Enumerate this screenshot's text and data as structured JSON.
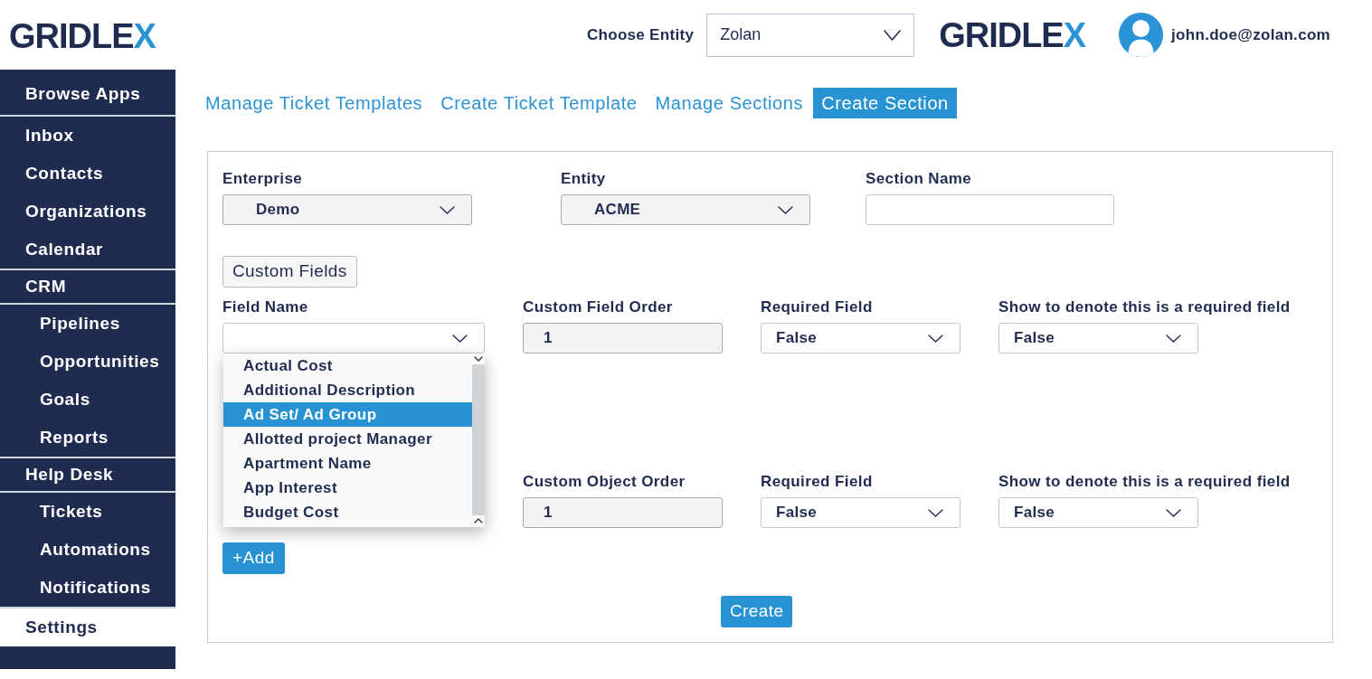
{
  "header": {
    "logo": "GRIDLEX",
    "entity_label": "Choose Entity",
    "entity_select": {
      "value": "Zolan"
    },
    "logo_right": "GRIDLEX",
    "user_email": "john.doe@zolan.com"
  },
  "sidebar": {
    "groups": [
      {
        "items": [
          {
            "label": "Browse Apps",
            "selected": false
          }
        ]
      },
      {
        "items": [
          {
            "label": "Inbox",
            "selected": false
          },
          {
            "label": "Contacts",
            "selected": false
          },
          {
            "label": "Organizations",
            "selected": false
          },
          {
            "label": "Calendar",
            "selected": false
          }
        ]
      },
      {
        "items": [
          {
            "label": "CRM",
            "selected": false,
            "children": [
              {
                "label": "Pipelines",
                "selected": false
              },
              {
                "label": "Opportunities",
                "selected": false
              },
              {
                "label": "Goals",
                "selected": false
              },
              {
                "label": "Reports",
                "selected": false
              }
            ]
          }
        ]
      },
      {
        "items": [
          {
            "label": "Help Desk",
            "selected": false,
            "children": [
              {
                "label": "Tickets",
                "selected": false
              },
              {
                "label": "Automations",
                "selected": false
              },
              {
                "label": "Notifications",
                "selected": false
              }
            ]
          }
        ]
      },
      {
        "items": [
          {
            "label": "Settings",
            "selected": true
          }
        ]
      }
    ]
  },
  "tabs": [
    {
      "label": "Manage Ticket Templates",
      "selected": false
    },
    {
      "label": "Create Ticket Template",
      "selected": false
    },
    {
      "label": "Manage Sections",
      "selected": false
    },
    {
      "label": "Create Section",
      "selected": true
    }
  ],
  "form": {
    "fields": [
      {
        "label": "Enterprise",
        "kind": "select",
        "value": "Demo",
        "disabled": true
      },
      {
        "label": "Entity",
        "kind": "select",
        "value": "ACME",
        "disabled": true
      },
      {
        "label": "Section Name",
        "kind": "text",
        "disabled": false
      }
    ],
    "custom_fields_button": "Custom Fields",
    "field_rows": [
      {
        "fields": [
          {
            "label": "Field Name",
            "kind": "select",
            "disabled": false,
            "expanded": true,
            "options": [
              {
                "label": "Actual Cost",
                "selected": false
              },
              {
                "label": "Additional Description",
                "selected": false
              },
              {
                "label": "Ad Set/ Ad Group",
                "selected": true
              },
              {
                "label": "Allotted project Manager",
                "selected": false
              },
              {
                "label": "Apartment Name",
                "selected": false
              },
              {
                "label": "App Interest",
                "selected": false
              },
              {
                "label": "Budget Cost",
                "selected": false
              }
            ]
          },
          {
            "label": "Custom Field Order",
            "kind": "text",
            "value": "1",
            "disabled": true
          },
          {
            "label": "Required Field",
            "kind": "select",
            "value": "False",
            "disabled": false
          },
          {
            "label": "Show to denote this is a required field",
            "kind": "select",
            "value": "False",
            "disabled": false
          }
        ]
      },
      {
        "fields": [
          {
            "label": "Custom Object Order",
            "kind": "text",
            "value": "1",
            "disabled": true
          },
          {
            "label": "Required Field",
            "kind": "select",
            "value": "False",
            "disabled": false
          },
          {
            "label": "Show to denote this is a required field",
            "kind": "select",
            "value": "False",
            "disabled": false
          }
        ]
      }
    ],
    "add_button": "+Add",
    "create_button": "Create"
  }
}
